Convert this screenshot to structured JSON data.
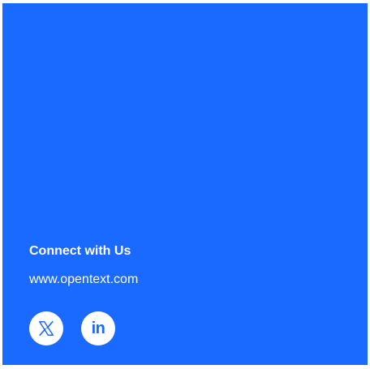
{
  "footer": {
    "heading": "Connect with Us",
    "website": "www.opentext.com",
    "social": [
      {
        "name": "x",
        "icon": "x-logo-icon"
      },
      {
        "name": "linkedin",
        "icon": "linkedin-logo-icon",
        "glyph": "in"
      }
    ]
  },
  "colors": {
    "background": "#1b6aff",
    "text": "#ffffff",
    "icon_circle": "#ffffff"
  }
}
